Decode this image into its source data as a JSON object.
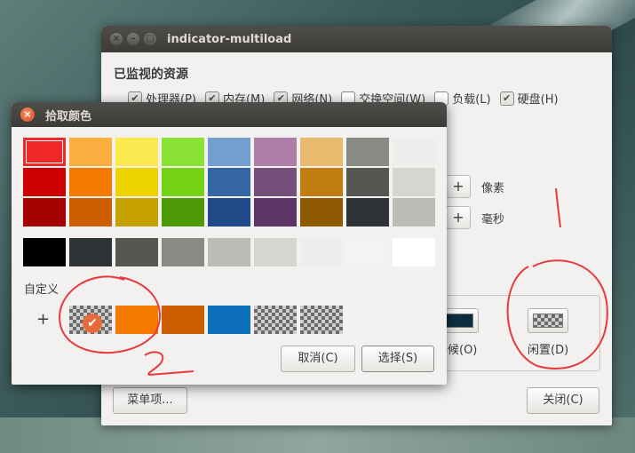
{
  "main_window": {
    "title": "indicator-multiload",
    "section_title": "已监视的资源",
    "checkboxes": [
      {
        "label": "处理器(P)",
        "checked": true
      },
      {
        "label": "内存(M)",
        "checked": true
      },
      {
        "label": "网络(N)",
        "checked": true
      },
      {
        "label": "交换空间(W)",
        "checked": false
      },
      {
        "label": "负载(L)",
        "checked": false
      },
      {
        "label": "硬盘(H)",
        "checked": true
      }
    ],
    "spin_units": {
      "width_unit": "像素",
      "interval_unit": "毫秒"
    },
    "color_labels": {
      "busy_partial": "等候(O)",
      "idle": "闲置(D)"
    },
    "menu_button": "菜单项...",
    "close_button": "关闭(C)"
  },
  "color_dialog": {
    "title": "拾取颜色",
    "palette": [
      [
        "#ef2929",
        "#cc0000",
        "#a40000"
      ],
      [
        "#fcaf3e",
        "#f57900",
        "#ce5c00"
      ],
      [
        "#fce94f",
        "#edd400",
        "#c4a000"
      ],
      [
        "#8ae234",
        "#73d216",
        "#4e9a06"
      ],
      [
        "#729fcf",
        "#3465a4",
        "#204a87"
      ],
      [
        "#ad7fa8",
        "#75507b",
        "#5c3566"
      ],
      [
        "#e9b96e",
        "#c17d11",
        "#8f5902"
      ],
      [
        "#888a85",
        "#555753",
        "#2e3436"
      ],
      [
        "#eeeeec",
        "#d3d7cf",
        "#babdb6"
      ]
    ],
    "grays": [
      "#000000",
      "#2e3436",
      "#555753",
      "#888a85",
      "#babdb6",
      "#d3d7cf",
      "#eeeeec",
      "#f3f3f3",
      "#ffffff"
    ],
    "custom_label": "自定义",
    "add_custom": "+",
    "custom_colors": [
      "checker",
      "#f57900",
      "#ce5c00",
      "#0a6fb8",
      "checker",
      "checker"
    ],
    "cancel_button": "取消(C)",
    "select_button": "选择(S)"
  },
  "annotations": {
    "mark_1": "1",
    "mark_2": "2"
  }
}
